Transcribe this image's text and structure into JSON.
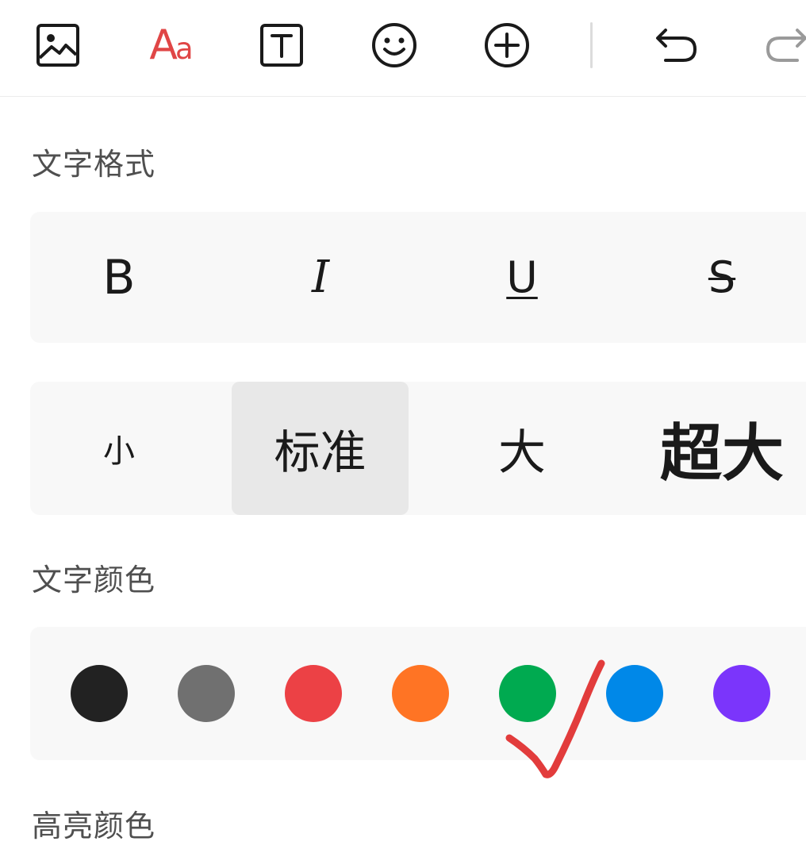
{
  "toolbar": {
    "items": [
      {
        "name": "image-icon"
      },
      {
        "name": "text-format-icon",
        "label_big": "A",
        "label_small": "a",
        "color": "#e04646"
      },
      {
        "name": "text-box-icon"
      },
      {
        "name": "emoji-icon"
      },
      {
        "name": "add-icon"
      },
      {
        "name": "undo-icon"
      },
      {
        "name": "redo-icon",
        "disabled": true
      }
    ]
  },
  "text_format": {
    "title": "文字格式",
    "styles": [
      {
        "label": "B",
        "name": "bold"
      },
      {
        "label": "I",
        "name": "italic"
      },
      {
        "label": "U",
        "name": "underline"
      },
      {
        "label": "S",
        "name": "strikethrough"
      }
    ],
    "sizes": [
      {
        "label": "小",
        "selected": false
      },
      {
        "label": "标准",
        "selected": true
      },
      {
        "label": "大",
        "selected": false
      },
      {
        "label": "超大",
        "selected": false
      }
    ]
  },
  "text_color": {
    "title": "文字颜色",
    "swatches": [
      "#222222",
      "#707070",
      "#ec4145",
      "#ff7424",
      "#00aa50",
      "#0088e8",
      "#7b35fb"
    ]
  },
  "highlight_color": {
    "title": "高亮颜色"
  },
  "annotation": {
    "checkmark_color": "#e23c3c"
  }
}
